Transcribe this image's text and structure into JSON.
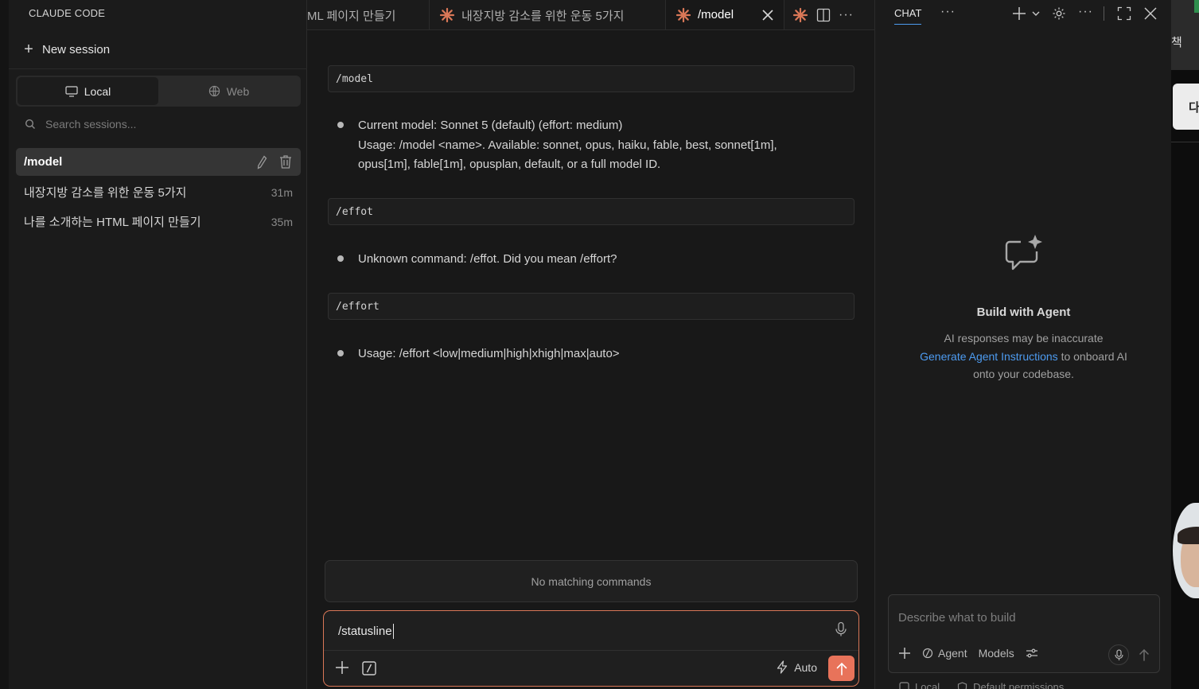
{
  "sidebar": {
    "title": "CLAUDE CODE",
    "new_session_label": "New session",
    "seg_local": "Local",
    "seg_web": "Web",
    "search_placeholder": "Search sessions...",
    "sessions": [
      {
        "name": "/model",
        "time": ""
      },
      {
        "name": "내장지방 감소를 위한 운동 5가지",
        "time": "31m"
      },
      {
        "name": "나를 소개하는 HTML 페이지 만들기",
        "time": "35m"
      }
    ]
  },
  "tabs": [
    {
      "label": "ML 페이지 만들기"
    },
    {
      "label": "내장지방 감소를 위한 운동 5가지"
    },
    {
      "label": "/model"
    }
  ],
  "conversation": {
    "cmd1": "/model",
    "resp1_line1": "Current model: Sonnet 5 (default) (effort: medium)",
    "resp1_line2": "Usage: /model <name>. Available: sonnet, opus, haiku, fable, best, sonnet[1m],",
    "resp1_line3": "opus[1m], fable[1m], opusplan, default, or a full model ID.",
    "cmd2": "/effot",
    "resp2": "Unknown command: /effot. Did you mean /effort?",
    "cmd3": "/effort",
    "resp3": "Usage: /effort <low|medium|high|xhigh|max|auto>"
  },
  "composer": {
    "no_match": "No matching commands",
    "value": "/statusline",
    "auto_label": "Auto"
  },
  "chat": {
    "tab_label": "CHAT",
    "empty_title": "Build with Agent",
    "empty_line1": "AI responses may be inaccurate",
    "empty_link": "Generate Agent Instructions",
    "empty_line2_rest": " to onboard AI",
    "empty_line3": "onto your codebase.",
    "input_placeholder": "Describe what to build",
    "agent_label": "Agent",
    "models_label": "Models",
    "footer_local": "Local",
    "footer_permissions": "Default permissions"
  },
  "background_app": {
    "char_top": "책",
    "char_card": "다"
  },
  "colors": {
    "accent": "#d97757",
    "link": "#4d9bf0",
    "send_button": "#e8735a"
  }
}
